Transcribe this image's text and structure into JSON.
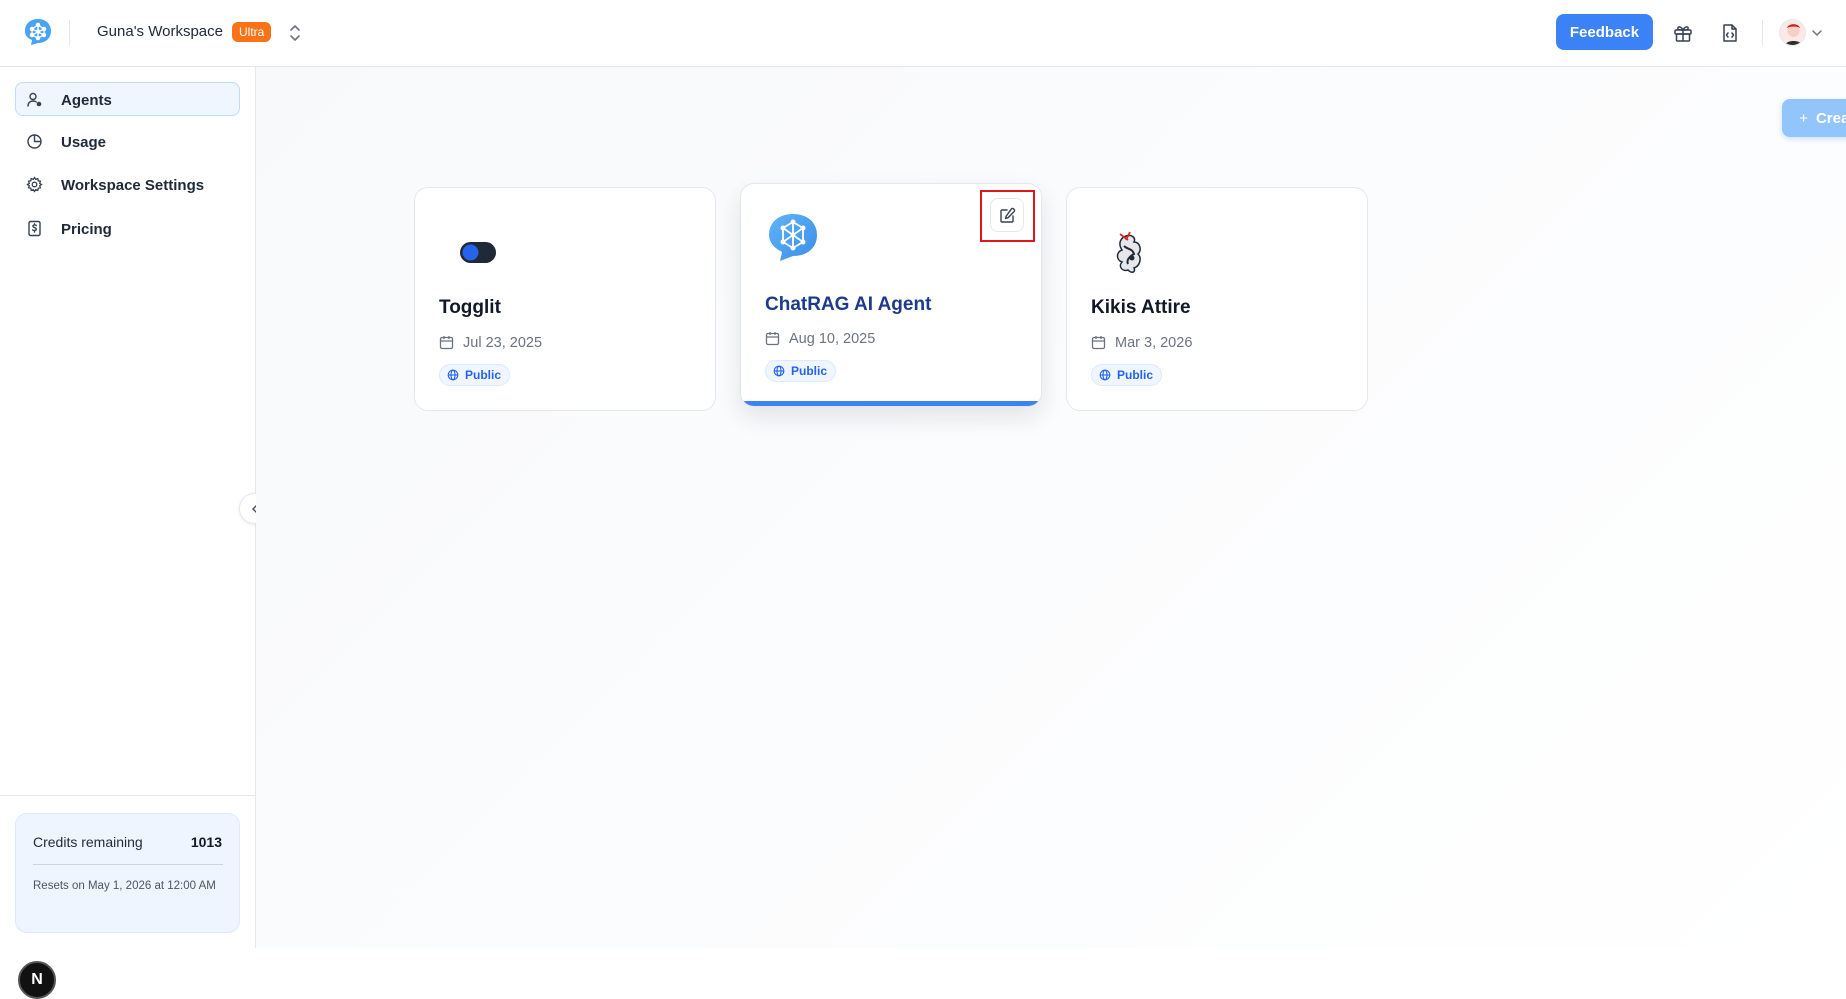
{
  "header": {
    "workspace_name": "Guna's Workspace",
    "plan_badge": "Ultra",
    "feedback_label": "Feedback",
    "icons": [
      "chatrag-logo-icon",
      "chevron-up-down-icon",
      "gift-icon",
      "code-file-icon",
      "avatar",
      "chevron-down-icon"
    ]
  },
  "sidebar": {
    "items": [
      {
        "label": "Agents",
        "icon": "user-icon",
        "active": true
      },
      {
        "label": "Usage",
        "icon": "pie-chart-icon",
        "active": false
      },
      {
        "label": "Workspace Settings",
        "icon": "gear-icon",
        "active": false
      },
      {
        "label": "Pricing",
        "icon": "dollar-receipt-icon",
        "active": false
      }
    ],
    "credits": {
      "label": "Credits remaining",
      "value": "1013",
      "reset_text": "Resets on May 1, 2026 at 12:00 AM"
    },
    "dev_badge": "N"
  },
  "main": {
    "create_label": "Create Agent",
    "agents": [
      {
        "name": "Togglit",
        "date": "Jul 23, 2025",
        "visibility": "Public",
        "icon": "toggle-icon"
      },
      {
        "name": "ChatRAG AI Agent",
        "date": "Aug 10, 2025",
        "visibility": "Public",
        "icon": "chatrag-logo-icon"
      },
      {
        "name": "Kikis Attire",
        "date": "Mar 3, 2026",
        "visibility": "Public",
        "icon": "kikis-attire-logo-icon"
      }
    ]
  },
  "colors": {
    "primary": "#3b82f6",
    "primary_light": "#93c5fd",
    "badge_orange": "#f97316",
    "highlight_red": "#e0161a"
  }
}
